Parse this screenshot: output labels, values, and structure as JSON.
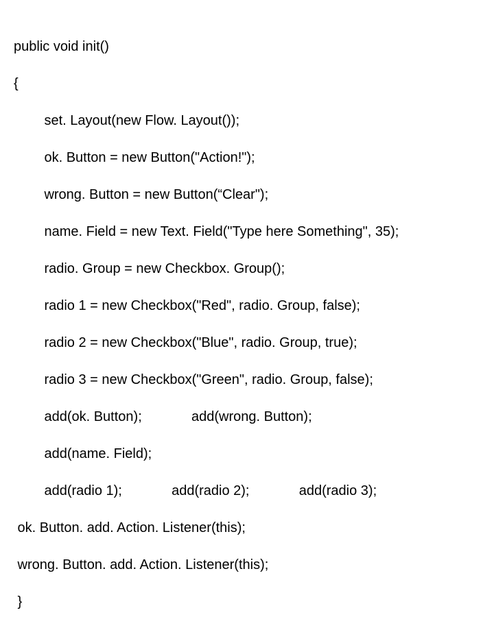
{
  "code": {
    "l1": "public void init()",
    "l2": "{",
    "l3": "        set. Layout(new Flow. Layout());",
    "l4": "        ok. Button = new Button(\"Action!\");",
    "l5": "        wrong. Button = new Button(“Clear\");",
    "l6": "        name. Field = new Text. Field(\"Type here Something\", 35);",
    "l7": "        radio. Group = new Checkbox. Group();",
    "l8": "        radio 1 = new Checkbox(\"Red\", radio. Group, false);",
    "l9": "        radio 2 = new Checkbox(\"Blue\", radio. Group, true);",
    "l10": "        radio 3 = new Checkbox(\"Green\", radio. Group, false);",
    "l11": "        add(ok. Button);             add(wrong. Button);",
    "l12": "        add(name. Field);",
    "l13": "        add(radio 1);             add(radio 2);             add(radio 3);",
    "l14": " ok. Button. add. Action. Listener(this);",
    "l15": " wrong. Button. add. Action. Listener(this);",
    "l16": " }"
  }
}
